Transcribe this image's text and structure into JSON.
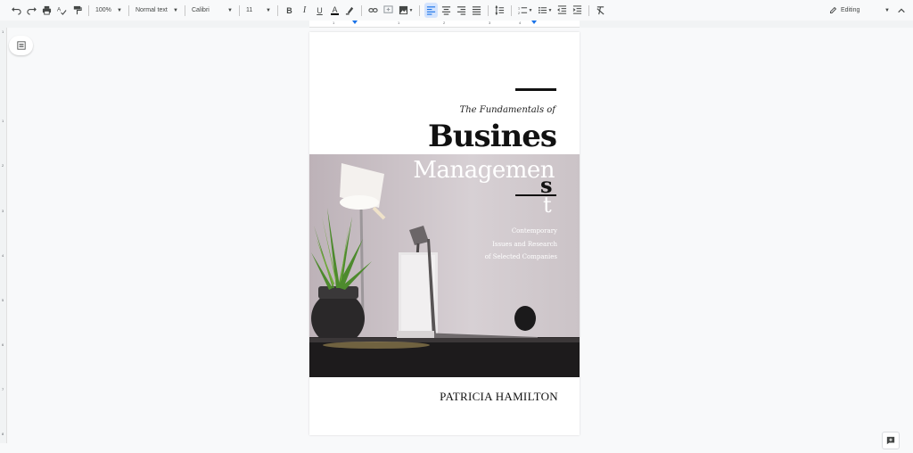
{
  "toolbar": {
    "zoom": "100%",
    "style": "Normal text",
    "font": "Calibri",
    "font_size": "11",
    "bold": "B",
    "italic": "I",
    "underline": "U",
    "text_color": "A",
    "mode": "Editing"
  },
  "ruler": {
    "h_numbers": [
      "1",
      "1",
      "2",
      "3",
      "4"
    ],
    "v_numbers": [
      "1",
      "1",
      "2",
      "3",
      "4",
      "5",
      "6",
      "7",
      "8"
    ]
  },
  "document": {
    "subtitle": "The Fundamentals of",
    "title_line1": "Busines",
    "title_line2": "Managemen",
    "title_overflow_s": "s",
    "title_overflow_t": "t",
    "description": [
      "Contemporary",
      "Issues and Research",
      "of Selected Companies"
    ],
    "author": "PATRICIA HAMILTON"
  },
  "colors": {
    "accent": "#1a73e8",
    "active_bg": "#d3e3fd"
  }
}
